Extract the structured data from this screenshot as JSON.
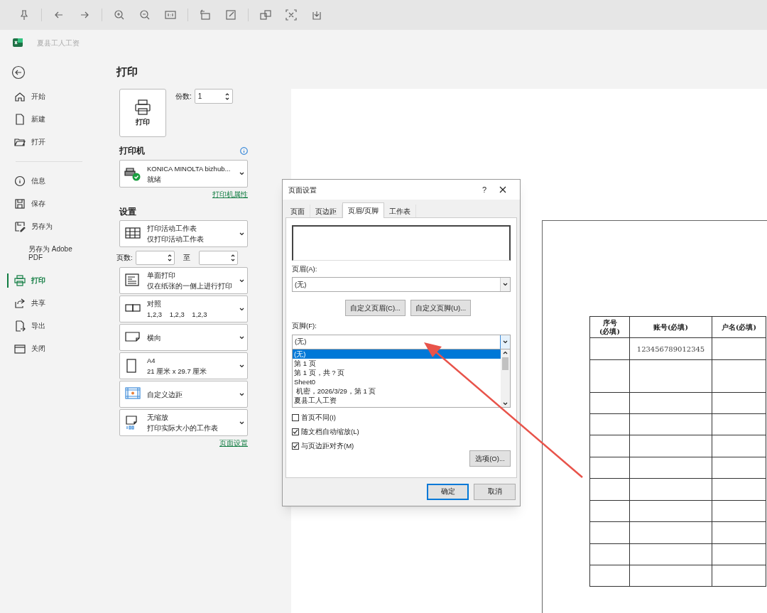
{
  "document_title": "夏县工人工资",
  "nav": {
    "groups": [
      [
        {
          "label": "开始",
          "selected": false
        },
        {
          "label": "新建",
          "selected": false
        },
        {
          "label": "打开",
          "selected": false
        }
      ],
      [
        {
          "label": "信息",
          "selected": false
        },
        {
          "label": "保存",
          "selected": false
        },
        {
          "label": "另存为",
          "selected": false
        },
        {
          "label": "另存为 Adobe PDF",
          "selected": false
        },
        {
          "label": "打印",
          "selected": true
        },
        {
          "label": "共享",
          "selected": false
        },
        {
          "label": "导出",
          "selected": false
        },
        {
          "label": "关闭",
          "selected": false
        }
      ]
    ]
  },
  "print_panel": {
    "title": "打印",
    "print_button": "打印",
    "copies_label": "份数:",
    "copies_value": "1",
    "printer_heading": "打印机",
    "printer_name": "KONICA MINOLTA bizhub...",
    "printer_status": "就绪",
    "printer_properties_link": "打印机属性",
    "settings_heading": "设置",
    "settings": [
      {
        "kind": "sheet",
        "line1": "打印活动工作表",
        "line2": "仅打印活动工作表"
      },
      {
        "kind": "pages",
        "label": "页数:",
        "to": "至"
      },
      {
        "kind": "sides",
        "line1": "单面打印",
        "line2": "仅在纸张的一侧上进行打印"
      },
      {
        "kind": "collate",
        "line1": "对照",
        "line2": "1,2,3    1,2,3    1,2,3"
      },
      {
        "kind": "orientation",
        "line1": "横向"
      },
      {
        "kind": "paper",
        "line1": "A4",
        "line2": "21 厘米 x 29.7 厘米"
      },
      {
        "kind": "margins",
        "line1": "自定义边距"
      },
      {
        "kind": "scaling",
        "line1": "无缩放",
        "line2": "打印实际大小的工作表"
      }
    ],
    "page_setup_link": "页面设置"
  },
  "dialog": {
    "title": "页面设置",
    "help": "?",
    "tabs": [
      {
        "label": "页面",
        "selected": false
      },
      {
        "label": "页边距",
        "selected": false
      },
      {
        "label": "页眉/页脚",
        "selected": true
      },
      {
        "label": "工作表",
        "selected": false
      }
    ],
    "header_label": "页眉(A):",
    "header_value": "(无)",
    "custom_header_button": "自定义页眉(C)...",
    "custom_footer_button": "自定义页脚(U)...",
    "footer_label": "页脚(F):",
    "footer_value": "(无)",
    "footer_options": [
      {
        "label": "(无)",
        "selected": true
      },
      {
        "label": "第 1 页",
        "selected": false
      },
      {
        "label": "第 1 页，共 ? 页",
        "selected": false
      },
      {
        "label": "Sheet0",
        "selected": false
      },
      {
        "label": " 机密，2026/3/29，第 1 页",
        "selected": false
      },
      {
        "label": "夏县工人工资",
        "selected": false
      }
    ],
    "checkboxes": [
      {
        "label": "首页不同(I)",
        "checked": false
      },
      {
        "label": "随文档自动缩放(L)",
        "checked": true
      },
      {
        "label": "与页边距对齐(M)",
        "checked": true
      }
    ],
    "options_button": "选项(O)...",
    "ok_button": "确定",
    "cancel_button": "取消"
  },
  "preview": {
    "columns": [
      "序号\n(必填)",
      "账号(必填)",
      "户名(必填)"
    ],
    "rows": [
      [
        "",
        "123456789012345",
        ""
      ],
      [
        "",
        "",
        ""
      ],
      [
        "",
        "",
        ""
      ],
      [
        "",
        "",
        ""
      ],
      [
        "",
        "",
        ""
      ],
      [
        "",
        "",
        ""
      ],
      [
        "",
        "",
        ""
      ],
      [
        "",
        "",
        ""
      ],
      [
        "",
        "",
        ""
      ],
      [
        "",
        "",
        ""
      ],
      [
        "",
        "",
        ""
      ]
    ]
  }
}
